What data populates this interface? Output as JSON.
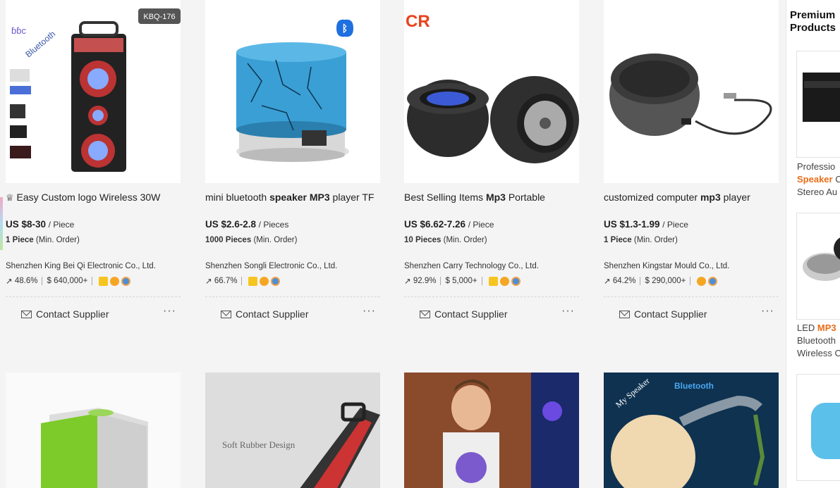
{
  "products": [
    {
      "badge_tag": "KBQ-176",
      "title_pre": "Easy Custom logo Wireless 30W",
      "title_bold": "",
      "title_post": "",
      "price": "US $8-30",
      "unit": "/ Piece",
      "min_qty": "1 Piece",
      "min_label": "(Min. Order)",
      "supplier": "Shenzhen King Bei Qi Electronic Co., Ltd.",
      "response_rate": "48.6%",
      "revenue": "640,000+",
      "badges": [
        "crown",
        "gold",
        "blue"
      ]
    },
    {
      "badge_tag": "",
      "title_pre": "mini bluetooth ",
      "title_bold": "speaker MP3",
      "title_post": " player TF",
      "price": "US $2.6-2.8",
      "unit": "/ Pieces",
      "min_qty": "1000 Pieces",
      "min_label": "(Min. Order)",
      "supplier": "Shenzhen Songli Electronic Co., Ltd.",
      "response_rate": "66.7%",
      "revenue": "",
      "badges": [
        "crown",
        "gold",
        "blue"
      ]
    },
    {
      "badge_tag": "",
      "title_pre": "Best Selling Items ",
      "title_bold": "Mp3",
      "title_post": " Portable",
      "price": "US $6.62-7.26",
      "unit": "/ Piece",
      "min_qty": "10 Pieces",
      "min_label": "(Min. Order)",
      "supplier": "Shenzhen Carry Technology Co., Ltd.",
      "response_rate": "92.9%",
      "revenue": "5,000+",
      "badges": [
        "crown",
        "gold",
        "blue"
      ]
    },
    {
      "badge_tag": "",
      "title_pre": "customized computer ",
      "title_bold": "mp3",
      "title_post": " player",
      "price": "US $1.3-1.99",
      "unit": "/ Piece",
      "min_qty": "1 Piece",
      "min_label": "(Min. Order)",
      "supplier": "Shenzhen Kingstar Mould Co., Ltd.",
      "response_rate": "64.2%",
      "revenue": "290,000+",
      "badges": [
        "gold",
        "blue"
      ]
    }
  ],
  "contact_label": "Contact Supplier",
  "more_label": "···",
  "row2_texts": {
    "soft_rubber": "Soft Rubber Design",
    "bluetooth": "Bluetooth",
    "my_speaker": "My Speaker"
  },
  "image_texts": {
    "brand_cr": "CR",
    "bluetooth_logo": "Bluetooth"
  },
  "sidebar": {
    "title_line1": "Premium",
    "title_line2": "Products",
    "item1_line1": "Professio",
    "item1_line2_hl": "Speaker",
    "item1_line2_rest": " C",
    "item1_line3": "Stereo Au",
    "item2_line1_pre": "LED ",
    "item2_line1_hl": "MP3",
    "item2_line2": "Bluetooth",
    "item2_line3": "Wireless C"
  },
  "colors": {
    "accent": "#e96d17",
    "badge_gold": "#f5a623",
    "badge_blue": "#4a8fd8"
  }
}
